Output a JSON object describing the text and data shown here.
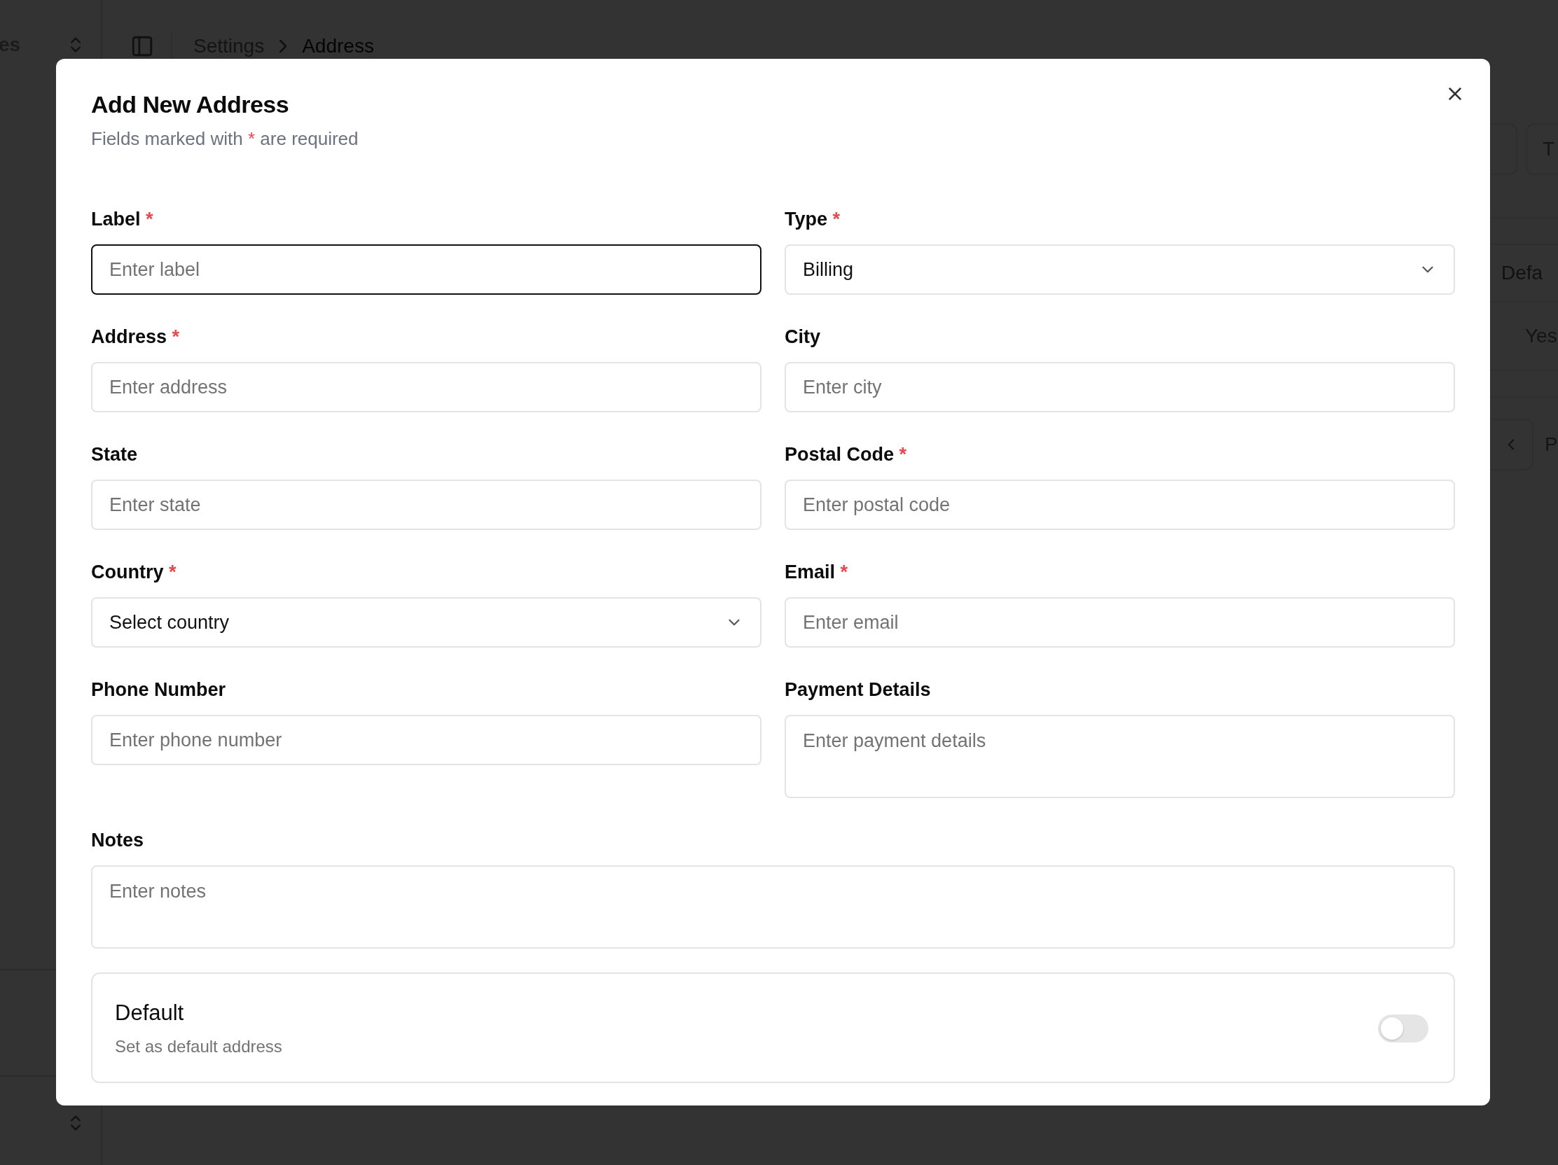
{
  "background": {
    "sidebar_title": "es",
    "breadcrumb": [
      "Settings",
      "Address"
    ],
    "tab_fragment": "T",
    "column_header_fragment": "Defa",
    "cell_fragment": "Yes",
    "pagination_fragment": "P"
  },
  "dialog": {
    "title": "Add New Address",
    "subtitle": {
      "before": "Fields marked with",
      "mark": "*",
      "after": "are required"
    },
    "fields": [
      {
        "kind": "input",
        "label": "Label",
        "required": true,
        "placeholder": "Enter label",
        "focused": true
      },
      {
        "kind": "select",
        "label": "Type",
        "required": true,
        "value": "Billing",
        "focused": false
      },
      {
        "kind": "input",
        "label": "Address",
        "required": true,
        "placeholder": "Enter address",
        "focused": false
      },
      {
        "kind": "input",
        "label": "City",
        "required": false,
        "placeholder": "Enter city",
        "focused": false
      },
      {
        "kind": "input",
        "label": "State",
        "required": false,
        "placeholder": "Enter state",
        "focused": false
      },
      {
        "kind": "input",
        "label": "Postal Code",
        "required": true,
        "placeholder": "Enter postal code",
        "focused": false
      },
      {
        "kind": "select",
        "label": "Country",
        "required": true,
        "value": "Select country",
        "focused": false
      },
      {
        "kind": "input",
        "label": "Email",
        "required": true,
        "placeholder": "Enter email",
        "focused": false
      },
      {
        "kind": "input",
        "label": "Phone Number",
        "required": false,
        "placeholder": "Enter phone number",
        "focused": false
      },
      {
        "kind": "textarea",
        "label": "Payment Details",
        "required": false,
        "placeholder": "Enter payment details",
        "focused": false
      },
      {
        "kind": "textarea",
        "label": "Notes",
        "required": false,
        "placeholder": "Enter notes",
        "focused": false,
        "wide": true
      }
    ],
    "default_option": {
      "title": "Default",
      "description": "Set as default address",
      "on": false
    }
  }
}
